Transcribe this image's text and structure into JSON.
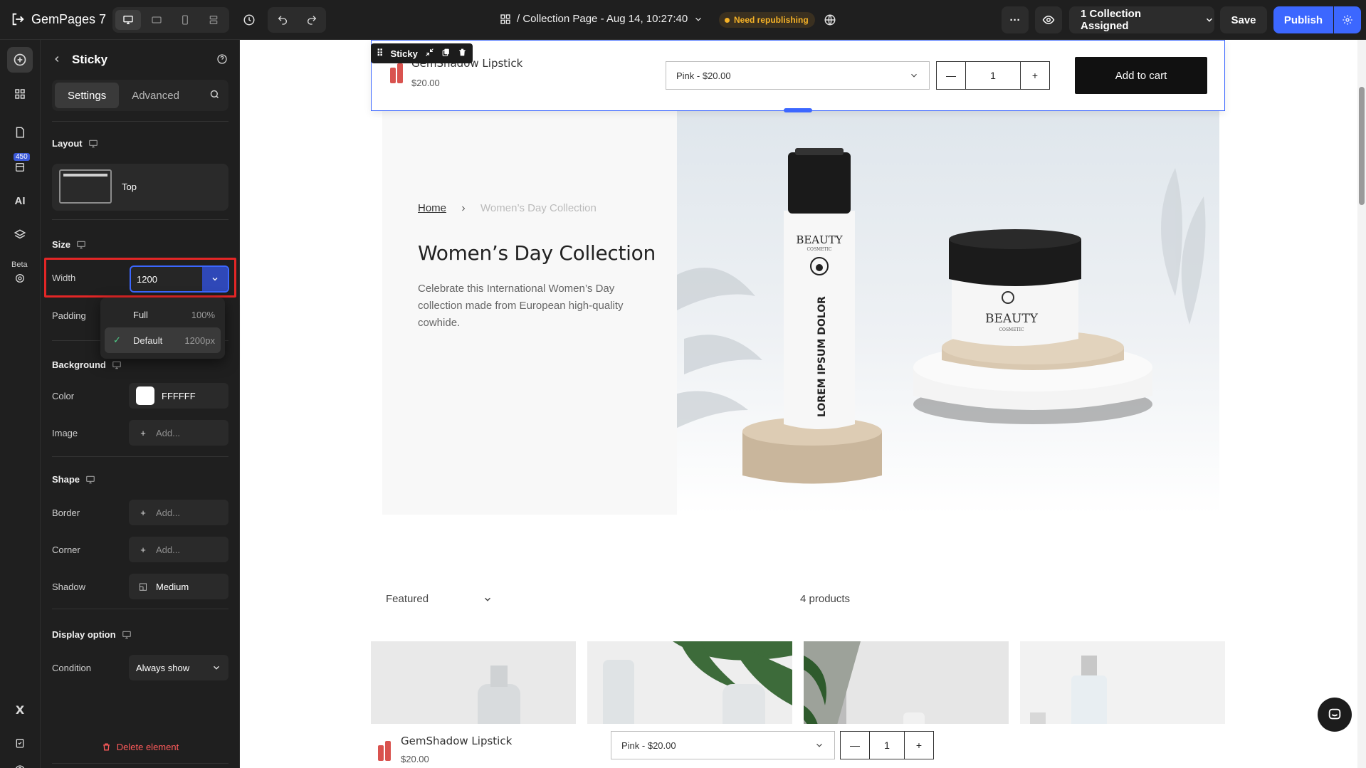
{
  "app": {
    "name": "GemPages 7"
  },
  "header": {
    "page_title": "/ Collection Page - Aug 14, 10:27:40",
    "status_badge": "Need republishing",
    "assigned_label": "1 Collection Assigned",
    "save_label": "Save",
    "publish_label": "Publish"
  },
  "rail": {
    "count_badge": "450",
    "ai_label": "AI",
    "beta_label": "Beta"
  },
  "panel": {
    "title": "Sticky",
    "tabs": [
      {
        "label": "Settings"
      },
      {
        "label": "Advanced"
      }
    ],
    "layout": {
      "heading": "Layout",
      "option": "Top"
    },
    "size": {
      "heading": "Size",
      "width_label": "Width",
      "width_value": "1200",
      "padding_label": "Padding"
    },
    "width_options": [
      {
        "label": "Full",
        "value": "100%"
      },
      {
        "label": "Default",
        "value": "1200px"
      }
    ],
    "background": {
      "heading": "Background",
      "color_label": "Color",
      "color_value": "FFFFFF",
      "image_label": "Image",
      "image_placeholder": "Add..."
    },
    "shape": {
      "heading": "Shape",
      "border_label": "Border",
      "border_placeholder": "Add...",
      "corner_label": "Corner",
      "corner_placeholder": "Add...",
      "shadow_label": "Shadow",
      "shadow_value": "Medium"
    },
    "display": {
      "heading": "Display option",
      "condition_label": "Condition",
      "condition_value": "Always show"
    },
    "delete_label": "Delete element"
  },
  "canvas": {
    "sticky_tag": "Sticky",
    "product": {
      "name": "GemShadow Lipstick",
      "price": "$20.00",
      "variant": "Pink - $20.00",
      "qty": "1",
      "add_to_cart": "Add to cart"
    },
    "hero": {
      "breadcrumb_home": "Home",
      "breadcrumb_current": "Women’s Day Collection",
      "title": "Women’s Day Collection",
      "description": "Celebrate this International Women’s Day collection made from European high-quality cowhide.",
      "bottle_brand": "BEAUTY",
      "bottle_sub": "COSMETIC",
      "bottle_text": "LOREM IPSUM DOLOR",
      "jar_brand": "BEAUTY",
      "jar_sub": "COSMETIC"
    },
    "sort_label": "Featured",
    "product_count": "4 products"
  },
  "colors": {
    "accent": "#3c67ff",
    "warning": "#f5b227",
    "danger": "#e32626",
    "panel_bg": "#1f1f1f"
  }
}
